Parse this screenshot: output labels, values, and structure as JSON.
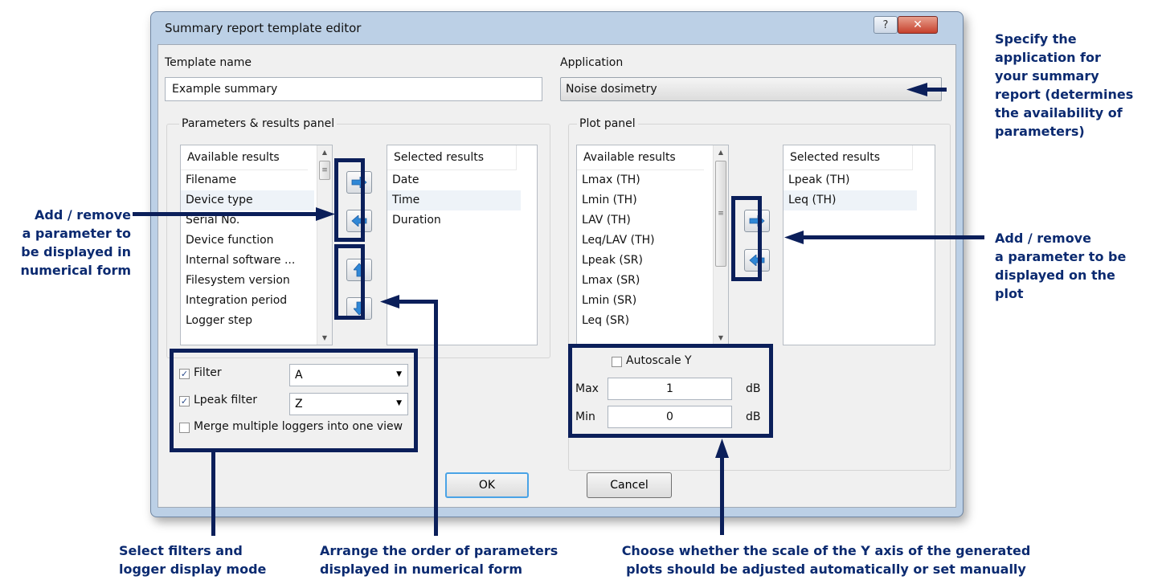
{
  "window": {
    "title": "Summary report template editor"
  },
  "template_name": {
    "label": "Template name",
    "value": "Example summary"
  },
  "application": {
    "label": "Application",
    "value": "Noise dosimetry"
  },
  "params_panel": {
    "title": "Parameters & results panel",
    "available_header": "Available results",
    "available": [
      "Filename",
      "Device type",
      "Serial No.",
      "Device function",
      "Internal software ...",
      "Filesystem version",
      "Integration period",
      "Logger step"
    ],
    "selected_header": "Selected results",
    "selected": [
      "Date",
      "Time",
      "Duration"
    ]
  },
  "plot_panel": {
    "title": "Plot panel",
    "available_header": "Available results",
    "available": [
      "Lmax (TH)",
      "Lmin (TH)",
      "LAV (TH)",
      "Leq/LAV (TH)",
      "Lpeak (SR)",
      "Lmax (SR)",
      "Lmin (SR)",
      "Leq (SR)"
    ],
    "selected_header": "Selected results",
    "selected": [
      "Lpeak (TH)",
      "Leq (TH)"
    ]
  },
  "filters": {
    "filter_label": "Filter",
    "filter_value": "A",
    "filter_checked": true,
    "lpeak_label": "Lpeak filter",
    "lpeak_value": "Z",
    "lpeak_checked": true,
    "merge_label": "Merge multiple loggers into one view",
    "merge_checked": false
  },
  "autoscale": {
    "label": "Autoscale Y",
    "checked": false,
    "max_label": "Max",
    "max_value": "1",
    "max_unit": "dB",
    "min_label": "Min",
    "min_value": "0",
    "min_unit": "dB"
  },
  "buttons": {
    "ok": "OK",
    "cancel": "Cancel"
  },
  "annotations": {
    "application": [
      "Specify the",
      "application for",
      "your summary",
      "report (determines",
      "the availability of",
      "parameters)"
    ],
    "add_remove_numeric": [
      "Add / remove",
      "a parameter to",
      "be displayed in",
      "numerical form"
    ],
    "add_remove_plot": [
      "Add / remove",
      "a parameter to be",
      "displayed on the",
      "plot"
    ],
    "filters": [
      "Select filters and",
      "logger display mode"
    ],
    "arrange": [
      "Arrange the order of parameters",
      "displayed in numerical form"
    ],
    "autoscale": [
      "Choose whether the scale of the Y axis of the generated",
      "plots should be adjusted automatically or set manually"
    ]
  },
  "colors": {
    "annotation": "#0b2a70",
    "frame": "#0b1f5a"
  },
  "icons": [
    "help-icon",
    "close-icon",
    "arrow-right-icon",
    "arrow-left-icon",
    "arrow-up-icon",
    "arrow-down-icon",
    "check-icon"
  ]
}
